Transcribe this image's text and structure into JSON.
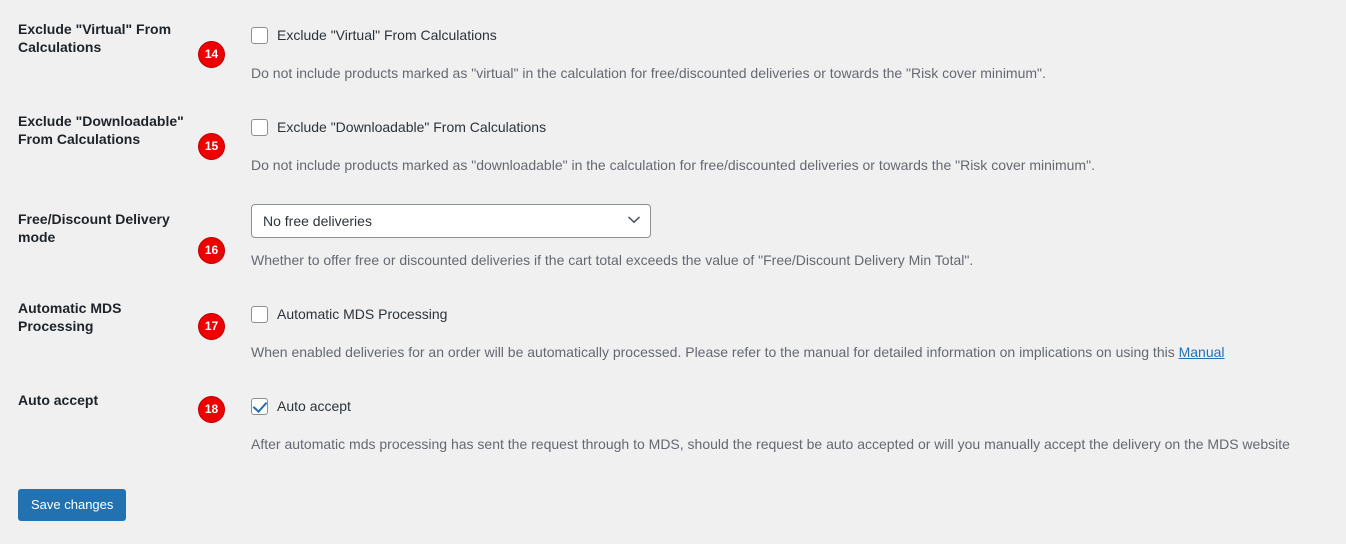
{
  "rows": [
    {
      "badge": "14",
      "label": "Exclude \"Virtual\" From Calculations",
      "checkbox_label": "Exclude \"Virtual\" From Calculations",
      "checked": false,
      "description": "Do not include products marked as \"virtual\" in the calculation for free/discounted deliveries or towards the \"Risk cover minimum\"."
    },
    {
      "badge": "15",
      "label": "Exclude \"Downloadable\" From Calculations",
      "checkbox_label": "Exclude \"Downloadable\" From Calculations",
      "checked": false,
      "description": "Do not include products marked as \"downloadable\" in the calculation for free/discounted deliveries or towards the \"Risk cover minimum\"."
    },
    {
      "badge": "16",
      "label": "Free/Discount Delivery mode",
      "select_value": "No free deliveries",
      "description": "Whether to offer free or discounted deliveries if the cart total exceeds the value of \"Free/Discount Delivery Min Total\"."
    },
    {
      "badge": "17",
      "label": "Automatic MDS Processing",
      "checkbox_label": "Automatic MDS Processing",
      "checked": false,
      "description_before_link": "When enabled deliveries for an order will be automatically processed. Please refer to the manual for detailed information on implications on using this ",
      "link_label": "Manual"
    },
    {
      "badge": "18",
      "label": "Auto accept",
      "checkbox_label": "Auto accept",
      "checked": true,
      "description": "After automatic mds processing has sent the request through to MDS, should the request be auto accepted or will you manually accept the delivery on the MDS website"
    }
  ],
  "icons": {
    "chevron_down": "chevron-down-icon",
    "checkmark": "checkmark-icon"
  },
  "submit": {
    "label": "Save changes"
  },
  "colors": {
    "badge_background": "#ee0000",
    "badge_border": "#c00000",
    "badge_text": "#ffffff",
    "page_background": "#f0f0f1",
    "label_text": "#1d2327",
    "description_text": "#646970",
    "link": "#2271b1",
    "button_background": "#2271b1",
    "checkbox_border": "#8c8f94",
    "checkmark": "#2271b1"
  }
}
